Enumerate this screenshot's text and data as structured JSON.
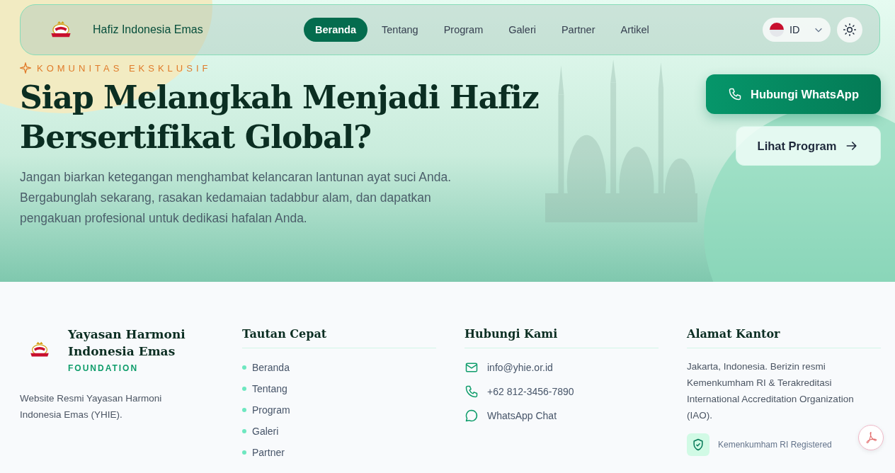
{
  "nav": {
    "title": "Hafiz Indonesia Emas",
    "links": [
      {
        "label": "Beranda",
        "selected": true
      },
      {
        "label": "Tentang",
        "selected": false
      },
      {
        "label": "Program",
        "selected": false
      },
      {
        "label": "Galeri",
        "selected": false
      },
      {
        "label": "Partner",
        "selected": false
      },
      {
        "label": "Artikel",
        "selected": false
      }
    ],
    "language": {
      "code": "ID"
    }
  },
  "hero": {
    "badge": "KOMUNITAS EKSKLUSIF",
    "title": "Siap Melangkah Menjadi Hafiz Bersertifikat Global?",
    "description": "Jangan biarkan ketegangan menghambat kelancaran lantunan ayat suci Anda. Bergabunglah sekarang, rasakan kedamaian tadabbur alam, dan dapatkan pengakuan profesional untuk dedikasi hafalan Anda.",
    "buttons": [
      {
        "label": "Hubungi WhatsApp",
        "kind": "primary"
      },
      {
        "label": "Lihat Program",
        "kind": "secondary"
      }
    ]
  },
  "footer": {
    "brand": {
      "name": "Yayasan Harmoni Indonesia Emas",
      "tagline": "FOUNDATION",
      "description": "Website Resmi Yayasan Harmoni Indonesia Emas (YHIE)."
    },
    "quick_links": {
      "title": "Tautan Cepat",
      "items": [
        "Beranda",
        "Tentang",
        "Program",
        "Galeri",
        "Partner"
      ]
    },
    "contact": {
      "title": "Hubungi Kami",
      "items": [
        {
          "kind": "email",
          "text": "info@yhie.or.id"
        },
        {
          "kind": "phone",
          "text": "+62 812-3456-7890"
        },
        {
          "kind": "chat",
          "text": "WhatsApp Chat"
        }
      ]
    },
    "address": {
      "title": "Alamat Kantor",
      "text": "Jakarta, Indonesia. Berizin resmi Kemenkumham RI & Terakreditasi International Accreditation Organization (IAO).",
      "badge": "Kemenkumham RI Registered"
    }
  }
}
